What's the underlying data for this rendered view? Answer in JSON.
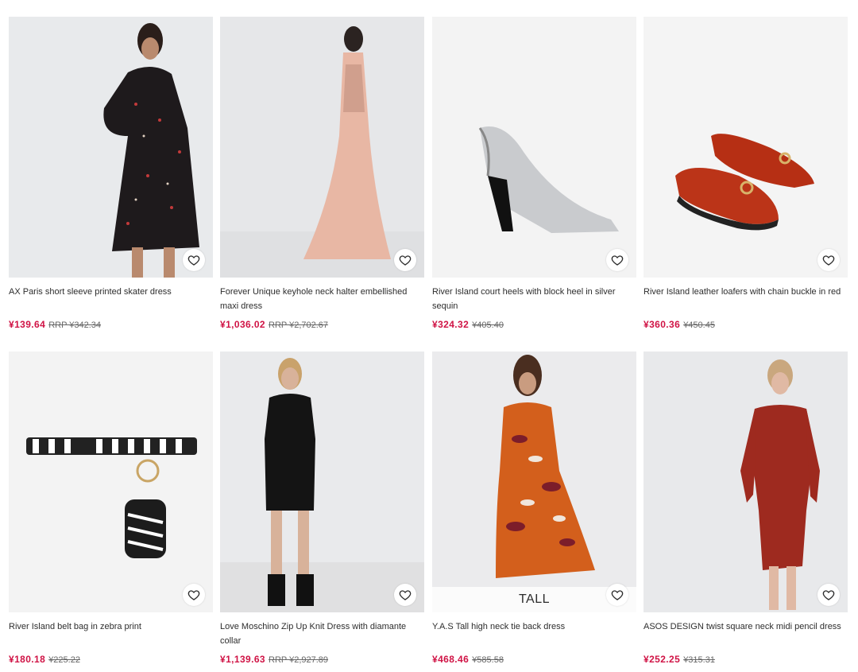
{
  "colors": {
    "sale_price": "#d01345",
    "text": "#2d2d2d",
    "strike_price": "#666666"
  },
  "products": [
    {
      "name": "AX Paris short sleeve printed skater dress",
      "price": "¥139.64",
      "old_price": "RRP ¥342.34",
      "badge": "",
      "icon": "heart-icon"
    },
    {
      "name": "Forever Unique keyhole neck halter embellished maxi dress",
      "price": "¥1,036.02",
      "old_price": "RRP ¥2,702.67",
      "badge": "",
      "icon": "heart-icon"
    },
    {
      "name": "River Island court heels with block heel in silver sequin",
      "price": "¥324.32",
      "old_price": "¥405.40",
      "badge": "",
      "icon": "heart-icon"
    },
    {
      "name": "River Island leather loafers with chain buckle in red",
      "price": "¥360.36",
      "old_price": "¥450.45",
      "badge": "",
      "icon": "heart-icon"
    },
    {
      "name": "River Island belt bag in zebra print",
      "price": "¥180.18",
      "old_price": "¥225.22",
      "badge": "",
      "icon": "heart-icon"
    },
    {
      "name": "Love Moschino Zip Up Knit Dress with diamante collar",
      "price": "¥1,139.63",
      "old_price": "RRP ¥2,927.89",
      "badge": "",
      "icon": "heart-icon"
    },
    {
      "name": "Y.A.S Tall high neck tie back dress",
      "price": "¥468.46",
      "old_price": "¥585.58",
      "badge": "TALL",
      "icon": "heart-icon"
    },
    {
      "name": "ASOS DESIGN twist square neck midi pencil dress",
      "price": "¥252.25",
      "old_price": "¥315.31",
      "badge": "",
      "icon": "heart-icon"
    }
  ]
}
